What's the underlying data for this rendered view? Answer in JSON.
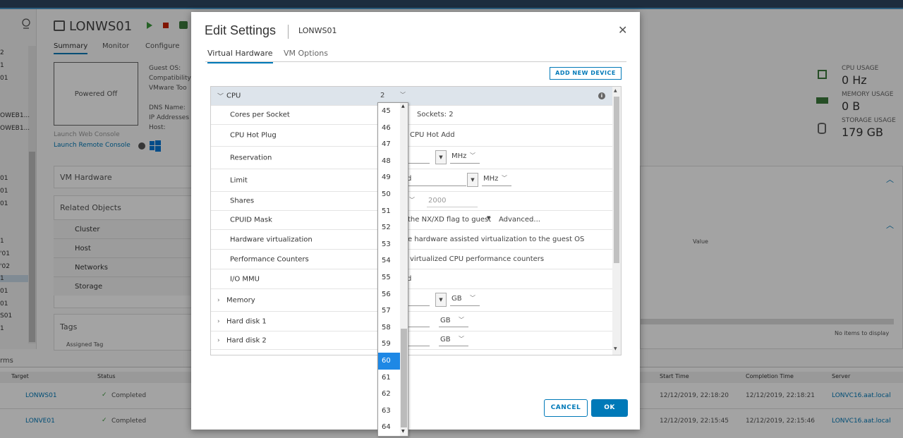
{
  "background": {
    "vm_name": "LONWS01",
    "tabs": [
      "Summary",
      "Monitor",
      "Configure"
    ],
    "power_state": "Powered Off",
    "info_labels": [
      "Guest OS:",
      "Compatibility",
      "VMware Too",
      "DNS Name:",
      "IP Addresses",
      "Host:"
    ],
    "launch_web_console": "Launch Web Console",
    "launch_remote_console": "Launch Remote Console",
    "vm_hardware": "VM Hardware",
    "related_objects": "Related Objects",
    "related_items": [
      "Cluster",
      "Host",
      "Networks",
      "Storage"
    ],
    "tags": "Tags",
    "assigned_tag": "Assigned Tag",
    "left_nav_items": [
      "2",
      "1",
      "01",
      "OWEB1...",
      "OWEB1...",
      "01",
      "01",
      "01",
      "1",
      "'01",
      "'02",
      "1",
      "01",
      "01",
      "S01",
      "1"
    ],
    "usage": {
      "cpu_label": "CPU USAGE",
      "cpu_value": "0 Hz",
      "memory_label": "MEMORY USAGE",
      "memory_value": "0 B",
      "storage_label": "STORAGE USAGE",
      "storage_value": "179 GB"
    },
    "value_header": "Value",
    "no_items": "No items to display",
    "alarms_label": "rms",
    "tasks": {
      "headers": [
        "Target",
        "Status",
        "Start Time",
        "Completion Time",
        "Server"
      ],
      "rows": [
        {
          "target": "LONWS01",
          "status": "Completed",
          "start": "12/12/2019, 22:18:20",
          "completion": "12/12/2019, 22:18:21",
          "server": "LONVC16.aat.local"
        },
        {
          "target": "LONVE01",
          "status": "Completed",
          "start": "12/12/2019, 22:15:45",
          "completion": "12/12/2019, 22:15:46",
          "server": "LONVC16.aat.local"
        }
      ]
    }
  },
  "modal": {
    "title": "Edit Settings",
    "subtitle": "LONWS01",
    "tabs": [
      "Virtual Hardware",
      "VM Options"
    ],
    "add_device": "ADD NEW DEVICE",
    "cpu": {
      "label": "CPU",
      "value": "2",
      "rows": [
        {
          "label": "Cores per Socket",
          "value": "Sockets: 2"
        },
        {
          "label": "CPU Hot Plug",
          "value": "CPU Hot Add"
        },
        {
          "label": "Reservation",
          "value": "",
          "unit": "MHz"
        },
        {
          "label": "Limit",
          "value": "d",
          "unit": "MHz"
        },
        {
          "label": "Shares",
          "value": "2000"
        },
        {
          "label": "CPUID Mask",
          "value": "the NX/XD flag to guest",
          "link": "Advanced..."
        },
        {
          "label": "Hardware virtualization",
          "value": "e hardware assisted virtualization to the guest OS"
        },
        {
          "label": "Performance Counters",
          "value": "virtualized CPU performance counters"
        },
        {
          "label": "I/O MMU",
          "value": "d"
        }
      ]
    },
    "memory": {
      "label": "Memory",
      "unit": "GB"
    },
    "disk1": {
      "label": "Hard disk 1",
      "unit": "GB"
    },
    "disk2": {
      "label": "Hard disk 2",
      "unit": "GB"
    },
    "cancel": "CANCEL",
    "ok": "OK",
    "cpu_options": [
      "45",
      "46",
      "47",
      "48",
      "49",
      "50",
      "51",
      "52",
      "53",
      "54",
      "55",
      "56",
      "57",
      "58",
      "59",
      "60",
      "61",
      "62",
      "63",
      "64"
    ],
    "cpu_selected": "60"
  }
}
